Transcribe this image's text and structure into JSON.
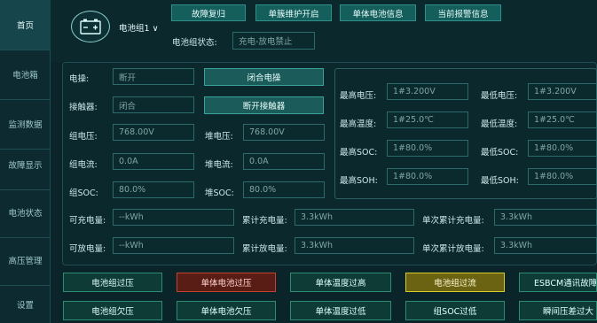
{
  "sidebar": {
    "items": [
      {
        "label": "首页"
      },
      {
        "label": "电池箱"
      },
      {
        "label": "监测数据"
      },
      {
        "label": "故障显示"
      },
      {
        "label": "电池状态"
      },
      {
        "label": "高压管理"
      },
      {
        "label": "设置"
      }
    ],
    "active_index": 0
  },
  "header": {
    "group_selector": "电池组1",
    "buttons": [
      {
        "label": "故障复归"
      },
      {
        "label": "单簇维护开启"
      },
      {
        "label": "单体电池信息"
      },
      {
        "label": "当前报警信息"
      }
    ],
    "status_label": "电池组状态:",
    "status_value": "充电-放电禁止"
  },
  "left_fields": {
    "operation_label": "电操:",
    "operation_value": "断开",
    "close_button": "闭合电操",
    "contactor_label": "接触器:",
    "contactor_value": "闭合",
    "open_button": "断开接触器",
    "group_voltage_label": "组电压:",
    "group_voltage_value": "768.00V",
    "stack_voltage_label": "堆电压:",
    "stack_voltage_value": "768.00V",
    "group_current_label": "组电流:",
    "group_current_value": "0.0A",
    "stack_current_label": "堆电流:",
    "stack_current_value": "0.0A",
    "group_soc_label": "组SOC:",
    "group_soc_value": "80.0%",
    "stack_soc_label": "堆SOC:",
    "stack_soc_value": "80.0%"
  },
  "right_box": {
    "max_voltage_label": "最高电压:",
    "max_voltage_value": "1#3.200V",
    "min_voltage_label": "最低电压:",
    "min_voltage_value": "1#3.200V",
    "max_temp_label": "最高温度:",
    "max_temp_value": "1#25.0℃",
    "min_temp_label": "最低温度:",
    "min_temp_value": "1#25.0℃",
    "max_soc_label": "最高SOC:",
    "max_soc_value": "1#80.0%",
    "min_soc_label": "最低SOC:",
    "min_soc_value": "1#80.0%",
    "max_soh_label": "最高SOH:",
    "max_soh_value": "1#80.0%",
    "min_soh_label": "最低SOH:",
    "min_soh_value": "1#80.0%"
  },
  "energy": {
    "chargeable_label": "可充电量:",
    "chargeable_value": "--kWh",
    "cum_charge_label": "累计充电量:",
    "cum_charge_value": "3.3kWh",
    "single_cum_charge_label": "单次累计充电量:",
    "single_cum_charge_value": "3.3kWh",
    "dischargeable_label": "可放电量:",
    "dischargeable_value": "--kWh",
    "cum_discharge_label": "累计放电量:",
    "cum_discharge_value": "3.3kWh",
    "single_cum_discharge_label": "单次累计放电量:",
    "single_cum_discharge_value": "3.3kWh"
  },
  "alarms": {
    "row1": [
      {
        "label": "电池组过压",
        "state": "normal"
      },
      {
        "label": "单体电池过压",
        "state": "red"
      },
      {
        "label": "单体温度过高",
        "state": "normal"
      },
      {
        "label": "电池组过流",
        "state": "yellow"
      },
      {
        "label": "ESBCM通讯故障",
        "state": "normal"
      }
    ],
    "row2": [
      {
        "label": "电池组欠压",
        "state": "normal"
      },
      {
        "label": "单体电池欠压",
        "state": "normal"
      },
      {
        "label": "单体温度过低",
        "state": "normal"
      },
      {
        "label": "组SOC过低",
        "state": "normal"
      },
      {
        "label": "瞬间压差过大",
        "state": "normal"
      }
    ]
  },
  "colors": {
    "background": "#0a2429",
    "accent": "#145e5c",
    "alarm_red": "#c4432c",
    "alarm_yellow": "#d6cd2a"
  }
}
